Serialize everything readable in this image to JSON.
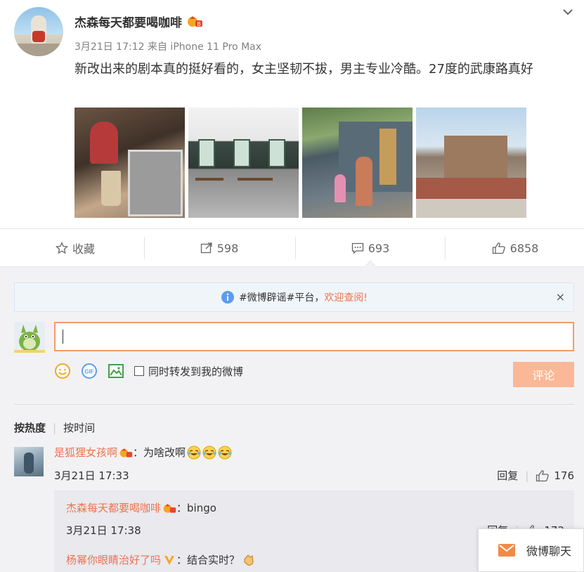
{
  "post": {
    "author": "杰森每天都要喝咖啡",
    "date": "3月21日 17:12",
    "source": "来自 iPhone 11 Pro Max",
    "text": "新改出来的剧本真的挺好看的，女主坚韧不拔，男主专业冷酷。27度的武康路真好",
    "photo_count": 4
  },
  "actions": {
    "favorite_label": "收藏",
    "repost_count": "598",
    "comment_count": "693",
    "like_count": "6858"
  },
  "notice": {
    "text": "#微博辟谣#平台，",
    "link": "欢迎查阅!",
    "close": "×"
  },
  "composer": {
    "value": "",
    "repost_label": "同时转发到我的微博",
    "submit_label": "评论"
  },
  "sort": {
    "hot": "按热度",
    "time": "按时间"
  },
  "comments": [
    {
      "user": "是狐狸女孩啊",
      "text": "：为啥改啊",
      "time": "3月21日 17:33",
      "reply_label": "回复",
      "likes": "176",
      "replies": [
        {
          "user": "杰森每天都要喝咖啡",
          "text": "：bingo",
          "time": "3月21日 17:38",
          "reply_label": "回复",
          "likes": "172"
        },
        {
          "user": "杨幂你眼睛治好了吗",
          "text": "：结合实时？"
        }
      ]
    }
  ],
  "chat_popup": {
    "label": "微博聊天"
  },
  "colors": {
    "accent": "#eb7350",
    "submit_disabled": "#fbb896",
    "input_border": "#f39c6b"
  }
}
